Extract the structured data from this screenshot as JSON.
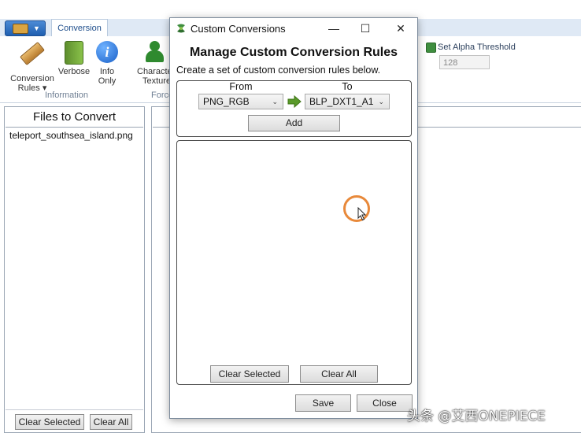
{
  "ribbon": {
    "tab_conversion": "Conversion",
    "buttons": {
      "conversion_rules": "Conversion\nRules",
      "conversion_rules_line1": "Conversion",
      "conversion_rules_line2": "Rules ▾",
      "verbose": "Verbose",
      "info_only_line1": "Info",
      "info_only_line2": "Only",
      "character_texture_line1": "Characte",
      "character_texture_line2": "Texture"
    },
    "groups": {
      "information": "Information",
      "force": "Force"
    },
    "alpha_threshold": {
      "label": "Set Alpha Threshold",
      "value": "128"
    }
  },
  "files_panel": {
    "title": "Files to Convert",
    "files": [
      "teleport_southsea_island.png"
    ],
    "clear_selected": "Clear Selected",
    "clear_all": "Clear All"
  },
  "dialog": {
    "title": "Custom Conversions",
    "heading": "Manage Custom Conversion Rules",
    "subtext": "Create a set of custom conversion rules below.",
    "from_label": "From",
    "to_label": "To",
    "from_value": "PNG_RGB",
    "to_value": "BLP_DXT1_A1",
    "add": "Add",
    "clear_selected": "Clear Selected",
    "clear_all": "Clear All",
    "save": "Save",
    "close": "Close",
    "window_controls": {
      "minimize": "—",
      "maximize": "☐",
      "close": "✕"
    }
  },
  "watermark": "头条 @艾西ONEPIECE",
  "colors": {
    "accent_green": "#5a9a2a",
    "cursor_ring": "#e8893a",
    "ribbon_tab_text": "#1f4e8c"
  }
}
